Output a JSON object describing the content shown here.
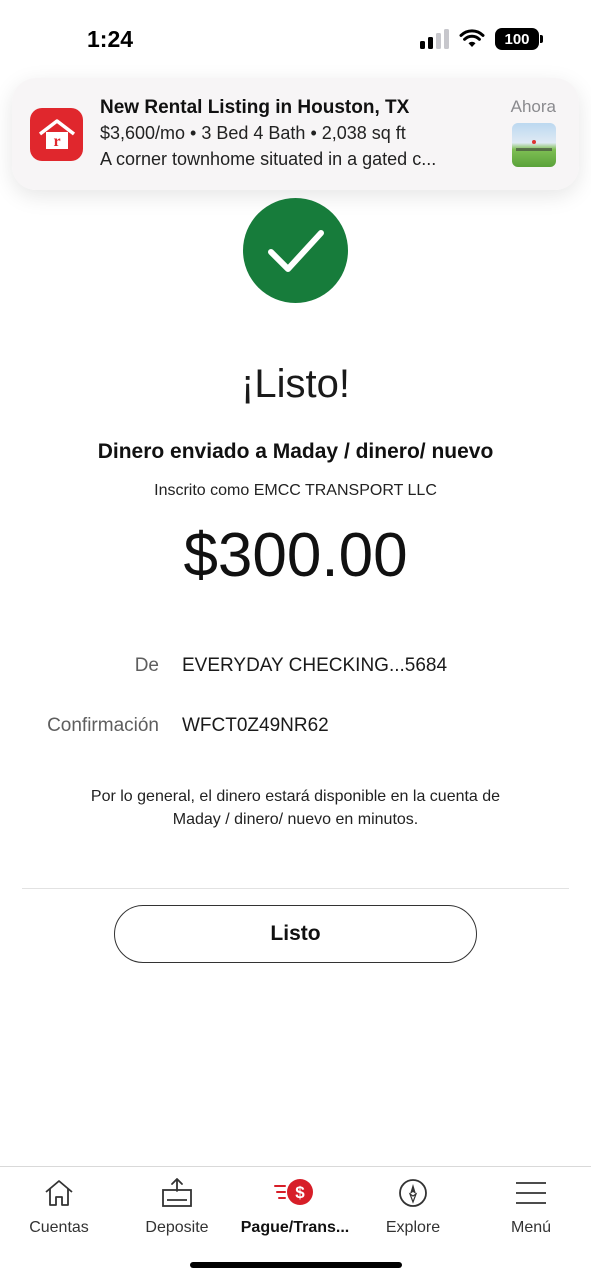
{
  "status_bar": {
    "time": "1:24",
    "battery": "100",
    "icons": [
      "signal-icon",
      "wifi-icon",
      "battery-icon"
    ]
  },
  "notification": {
    "title": "New Rental Listing in Houston, TX",
    "line1": "$3,600/mo • 3 Bed 4 Bath • 2,038 sq ft",
    "line2": "A corner townhome situated in a gated c...",
    "time": "Ahora",
    "app_icon": "rent-app-icon",
    "thumbnail": "listing-photo-thumbnail"
  },
  "confirmation": {
    "title": "¡Listo!",
    "subtitle": "Dinero enviado a Maday / dinero/ nuevo",
    "enrolled": "Inscrito como EMCC TRANSPORT LLC",
    "amount": "$300.00",
    "from_label": "De",
    "from_value": "EVERYDAY CHECKING...5684",
    "confirmation_label": "Confirmación",
    "confirmation_value": "WFCT0Z49NR62",
    "note": "Por lo general, el dinero estará disponible en la cuenta de Maday / dinero/ nuevo en minutos.",
    "done_button": "Listo",
    "check_color": "#177c3b"
  },
  "tab_bar": {
    "items": [
      {
        "label": "Cuentas",
        "icon": "home-icon"
      },
      {
        "label": "Deposite",
        "icon": "deposit-icon"
      },
      {
        "label": "Pague/Trans...",
        "icon": "pay-transfer-icon",
        "active": true
      },
      {
        "label": "Explore",
        "icon": "compass-icon"
      },
      {
        "label": "Menú",
        "icon": "menu-icon"
      }
    ],
    "accent_color": "#d71e28"
  }
}
